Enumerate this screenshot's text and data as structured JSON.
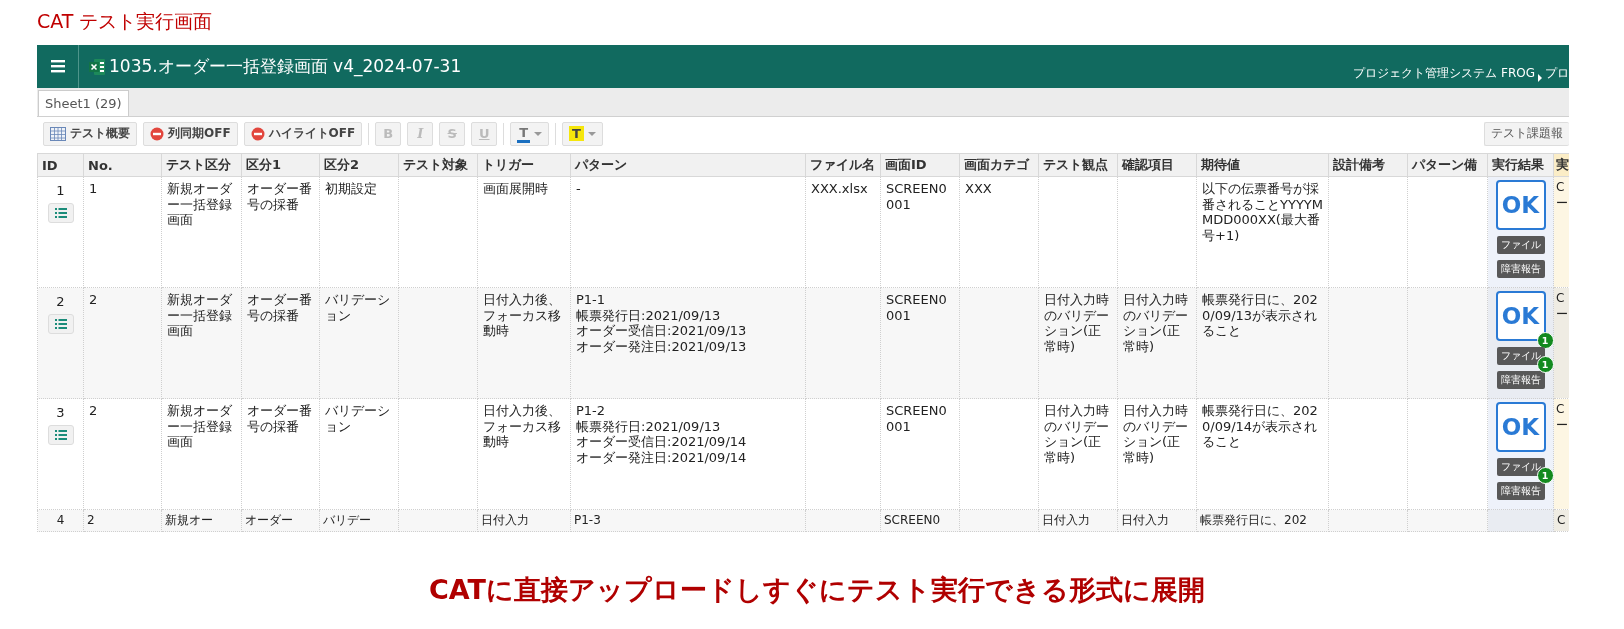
{
  "page_title": "CAT テスト実行画面",
  "app": {
    "title": "1035.オーダー一括登録画面 v4_2024-07-31",
    "breadcrumb": [
      "プロジェクト管理システム FROG",
      "プロ"
    ]
  },
  "tabs": [
    {
      "label": "Sheet1 (29)",
      "selected": true
    }
  ],
  "toolbar": [
    {
      "kind": "overview",
      "label": "テスト概要"
    },
    {
      "kind": "toggle",
      "label": "列同期OFF"
    },
    {
      "kind": "toggle",
      "label": "ハイライトOFF"
    },
    {
      "kind": "format",
      "label": "B",
      "disabled": true
    },
    {
      "kind": "format",
      "label": "I",
      "disabled": true
    },
    {
      "kind": "format",
      "label": "S",
      "disabled": true
    },
    {
      "kind": "format",
      "label": "U",
      "disabled": true
    },
    {
      "kind": "text-color",
      "label": "T",
      "color": "#1a6fc0"
    },
    {
      "kind": "highlight",
      "label": "T",
      "color": "#f5e60c"
    }
  ],
  "report_button": "テスト課題報",
  "table": {
    "columns": [
      "ID",
      "No.",
      "テスト区分",
      "区分1",
      "区分2",
      "テスト対象",
      "トリガー",
      "パターン",
      "ファイル名",
      "画面ID",
      "画面カテゴ",
      "テスト観点",
      "確認項目",
      "期待値",
      "設計備考",
      "パターン備",
      "実行結果",
      "実"
    ],
    "rows": [
      {
        "cells": [
          "1",
          "1",
          "新規オーダー一括登録画面",
          "オーダー番号の採番",
          "初期設定",
          null,
          "画面展開時",
          "-",
          "XXX.xlsx",
          "SCREEN0001",
          "XXX",
          null,
          null,
          "以下の伝票番号が採番されることYYYYMMDD000XX(最大番号+1)",
          null,
          null
        ],
        "result": "OK",
        "file_button": "ファイル",
        "defect_button": "障害報告",
        "extra": "C\nー"
      },
      {
        "cells": [
          "2",
          "2",
          "新規オーダー一括登録画面",
          "オーダー番号の採番",
          "バリデーション",
          null,
          "日付入力後、フォーカス移動時",
          "P1-1\n帳票発行日:2021/09/13\nオーダー受信日:2021/09/13\nオーダー発注日:2021/09/13",
          null,
          "SCREEN0001",
          null,
          "日付入力時のバリデーション(正常時)",
          "日付入力時のバリデーション(正常時)",
          "帳票発行日に、2020/09/13が表示されること",
          null,
          null
        ],
        "result": "OK",
        "result_badge": "1",
        "file_button": "ファイル",
        "file_badge": "1",
        "defect_button": "障害報告",
        "extra": "C\nー"
      },
      {
        "cells": [
          "3",
          "2",
          "新規オーダー一括登録画面",
          "オーダー番号の採番",
          "バリデーション",
          null,
          "日付入力後、フォーカス移動時",
          "P1-2\n帳票発行日:2021/09/13\nオーダー受信日:2021/09/14\nオーダー発注日:2021/09/14",
          null,
          "SCREEN0001",
          null,
          "日付入力時のバリデーション(正常時)",
          "日付入力時のバリデーション(正常時)",
          "帳票発行日に、2020/09/14が表示されること",
          null,
          null
        ],
        "result": "OK",
        "file_button": "ファイル",
        "file_badge": "1",
        "defect_button": "障害報告",
        "extra": "C\nー"
      },
      {
        "cells": [
          "4",
          "2",
          "新規オー",
          "オーダー",
          "バリデー",
          null,
          "日付入力",
          "P1-3",
          null,
          "SCREEN0",
          null,
          "日付入力",
          "日付入力",
          "帳票発行日に、202",
          null,
          null
        ],
        "extra": "C"
      }
    ]
  },
  "caption": "CATに直接アップロードしすぐにテスト実行できる形式に展開"
}
